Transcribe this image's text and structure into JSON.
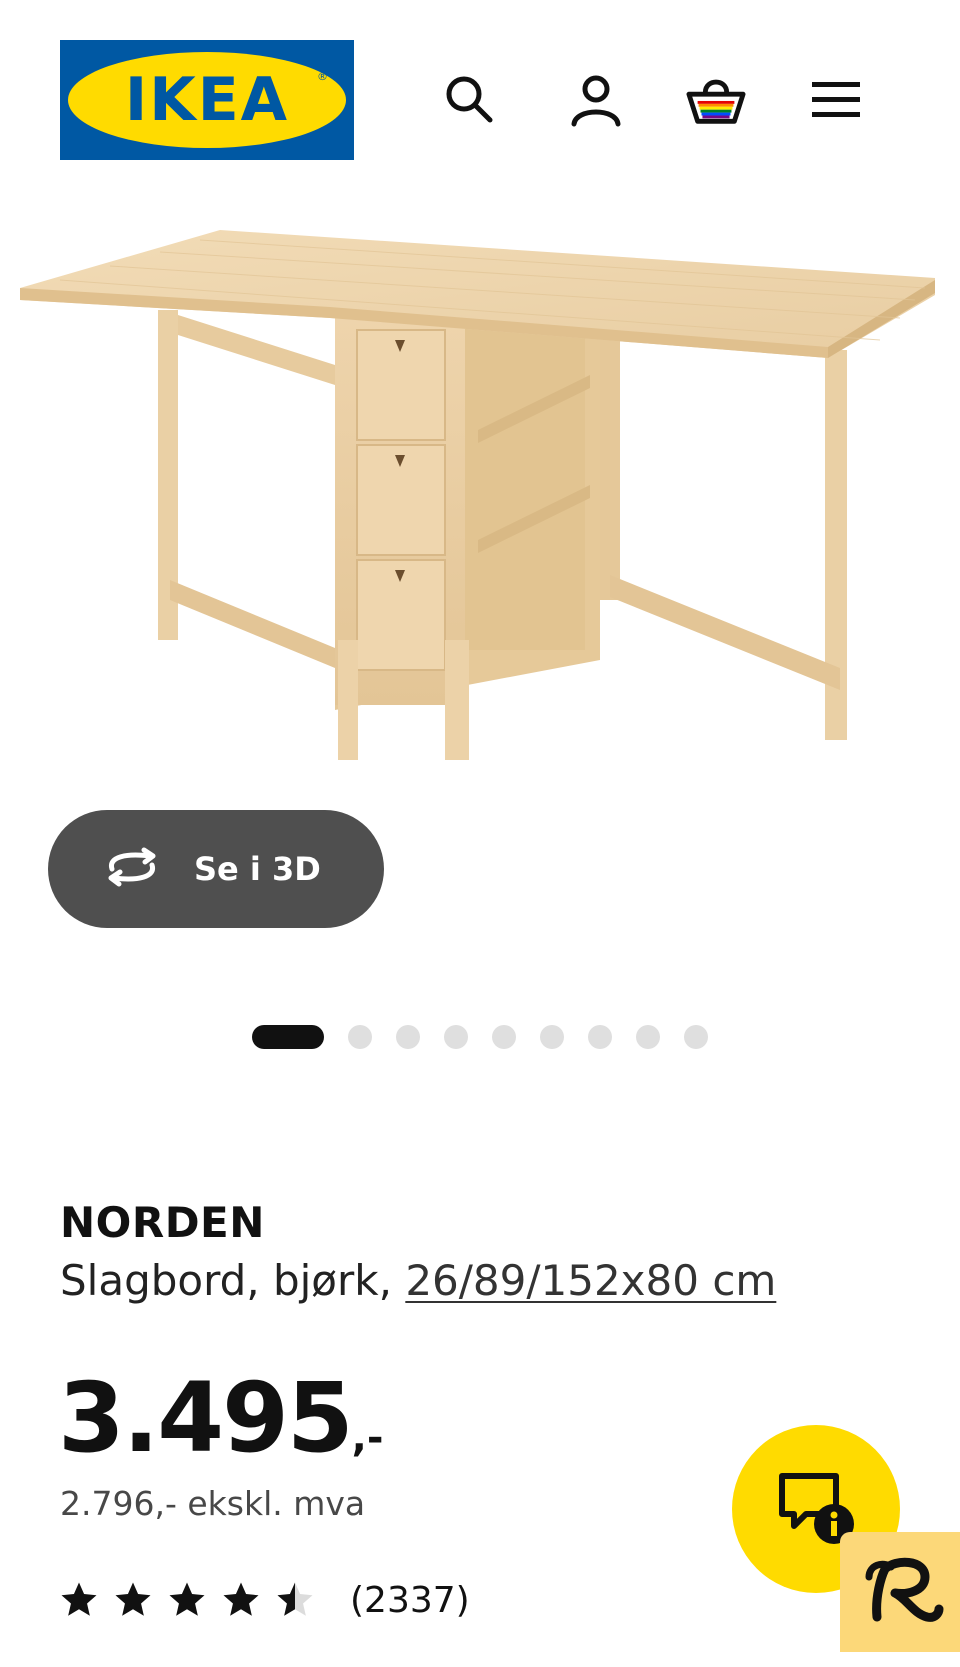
{
  "header": {
    "logo_text": "IKEA",
    "logo_reg": "®",
    "icons": [
      "search-icon",
      "account-icon",
      "basket-icon",
      "menu-icon"
    ]
  },
  "media": {
    "view_3d_label": "Se i 3D",
    "carousel": {
      "total": 9,
      "active": 1
    }
  },
  "product": {
    "name": "NORDEN",
    "description": "Slagbord, bjørk,",
    "size_link": "26/89/152x80 cm",
    "price_main": "3.495",
    "price_suffix": ",-",
    "price_ex_vat": "2.796,- ekskl. mva",
    "rating_value": 4.5,
    "rating_max": 5,
    "review_count": "(2337)"
  },
  "colors": {
    "ikea_blue": "#0058a3",
    "ikea_yellow": "#ffdb00",
    "button_dark": "#4f4f4f",
    "badge_yellow": "#fcd879"
  }
}
